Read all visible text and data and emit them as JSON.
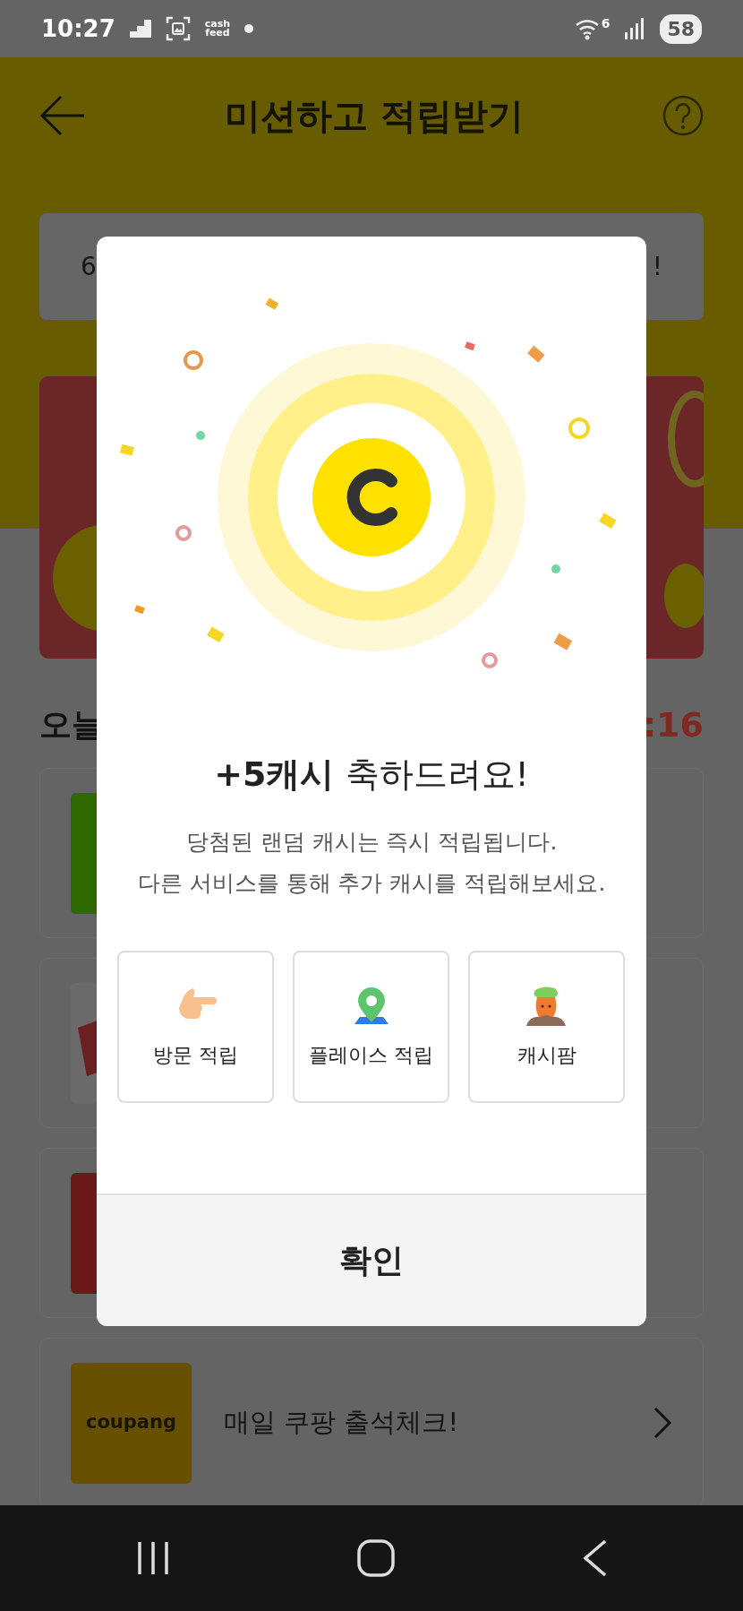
{
  "status_bar": {
    "time": "10:27",
    "app_label": [
      "cash",
      "feed"
    ],
    "network": "6",
    "battery": "58"
  },
  "header": {
    "title": "미션하고 적립받기"
  },
  "notice": {
    "start": "6",
    "end": "!"
  },
  "today": {
    "heading": "오늘",
    "timer": ":16"
  },
  "cards": [
    {
      "kind": "green"
    },
    {
      "kind": "ticket"
    },
    {
      "kind": "red"
    },
    {
      "kind": "coupang",
      "logo": "coupang",
      "title": "매일 쿠팡 출석체크!"
    }
  ],
  "dialog": {
    "title": "**+5캐시** 축하드려요!",
    "message_lines": [
      "당첨된 랜덤 캐시는 즉시 적립됩니다.",
      "다른 서비스를 통해 추가 캐시를 적립해보세요."
    ],
    "services": [
      {
        "label": "방문 적립"
      },
      {
        "label": "플레이스 적립"
      },
      {
        "label": "캐시팜"
      }
    ],
    "confirm": "확인"
  }
}
